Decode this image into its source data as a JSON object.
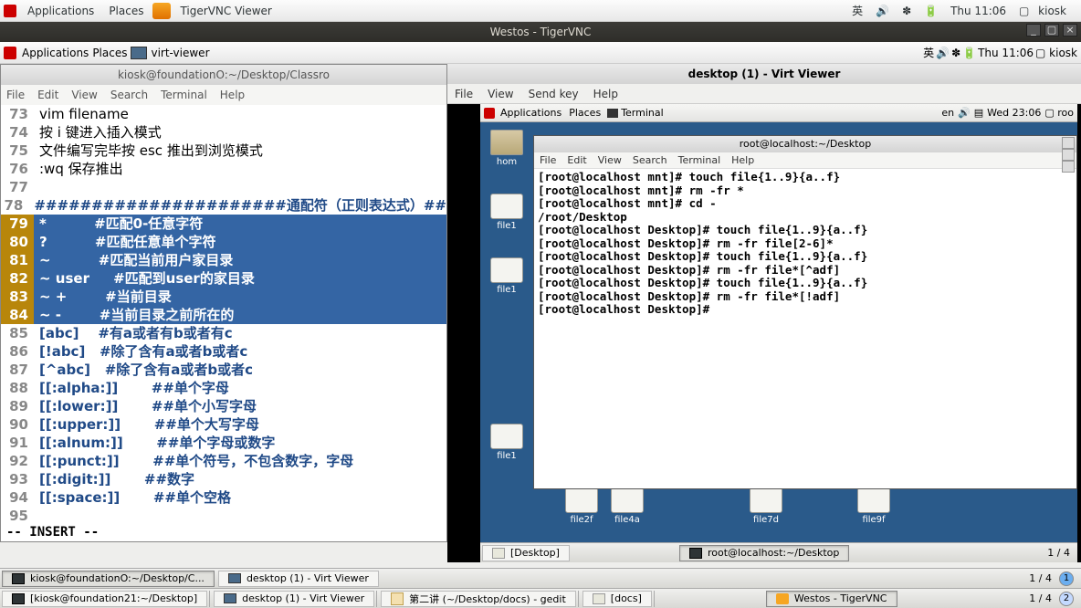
{
  "outer_panel": {
    "apps": "Applications",
    "places": "Places",
    "app_label": "TigerVNC Viewer",
    "ime": "英",
    "clock": "Thu 11:06",
    "user": "kiosk"
  },
  "vnc_title": "Westos - TigerVNC",
  "inner_panel": {
    "apps": "Applications",
    "places": "Places",
    "app_label": "virt-viewer",
    "ime": "英",
    "clock": "Thu 11:06",
    "user": "kiosk"
  },
  "gedit": {
    "title": "kiosk@foundationO:~/Desktop/Classro",
    "menu": [
      "File",
      "Edit",
      "View",
      "Search",
      "Terminal",
      "Help"
    ],
    "lines": [
      {
        "n": "73",
        "sel": false,
        "text": "vim filename",
        "style": "plain"
      },
      {
        "n": "74",
        "sel": false,
        "text": "按 i 键进入插入模式",
        "style": "plain"
      },
      {
        "n": "75",
        "sel": false,
        "text": "文件编写完毕按 esc 推出到浏览模式",
        "style": "plain"
      },
      {
        "n": "76",
        "sel": false,
        "text": ":wq 保存推出",
        "style": "plain"
      },
      {
        "n": "77",
        "sel": false,
        "text": "",
        "style": "plain"
      },
      {
        "n": "78",
        "sel": false,
        "text": "######################通配符（正则表达式）##",
        "style": "blue"
      },
      {
        "n": "79",
        "sel": true,
        "text": "*          #匹配0-任意字符",
        "style": "sel"
      },
      {
        "n": "80",
        "sel": true,
        "text": "?          #匹配任意单个字符",
        "style": "sel"
      },
      {
        "n": "81",
        "sel": true,
        "text": "~          #匹配当前用户家目录",
        "style": "sel"
      },
      {
        "n": "82",
        "sel": true,
        "text": "~ user     #匹配到user的家目录",
        "style": "sel"
      },
      {
        "n": "83",
        "sel": true,
        "text": "~ +        #当前目录",
        "style": "sel"
      },
      {
        "n": "84",
        "sel": true,
        "text": "~ -        #当前目录之前所在的",
        "style": "sel"
      },
      {
        "n": "85",
        "sel": false,
        "text": "[abc]    #有a或者有b或者有c",
        "style": "blue"
      },
      {
        "n": "86",
        "sel": false,
        "text": "[!abc]   #除了含有a或者b或者c",
        "style": "blue"
      },
      {
        "n": "87",
        "sel": false,
        "text": "[^abc]   #除了含有a或者b或者c",
        "style": "blue"
      },
      {
        "n": "88",
        "sel": false,
        "text": "[[:alpha:]]       ##单个字母",
        "style": "blue"
      },
      {
        "n": "89",
        "sel": false,
        "text": "[[:lower:]]       ##单个小写字母",
        "style": "blue"
      },
      {
        "n": "90",
        "sel": false,
        "text": "[[:upper:]]       ##单个大写字母",
        "style": "blue"
      },
      {
        "n": "91",
        "sel": false,
        "text": "[[:alnum:]]       ##单个字母或数字",
        "style": "blue"
      },
      {
        "n": "92",
        "sel": false,
        "text": "[[:punct:]]       ##单个符号，不包含数字，字母",
        "style": "blue"
      },
      {
        "n": "93",
        "sel": false,
        "text": "[[:digit:]]       ##数字",
        "style": "blue"
      },
      {
        "n": "94",
        "sel": false,
        "text": "[[:space:]]       ##单个空格",
        "style": "blue"
      },
      {
        "n": "95",
        "sel": false,
        "text": "",
        "style": "plain"
      }
    ],
    "status": "-- INSERT --"
  },
  "virt": {
    "title": "desktop (1) - Virt Viewer",
    "menu": [
      "File",
      "View",
      "Send key",
      "Help"
    ],
    "panel": {
      "apps": "Applications",
      "places": "Places",
      "app": "Terminal",
      "ime": "en",
      "clock": "Wed 23:06",
      "user": "roo"
    },
    "home": "hom",
    "icons_left": [
      "file1",
      "file1"
    ],
    "icons_bottom": [
      "file2f",
      "file4a",
      "file7d",
      "file9f"
    ],
    "icons_row2_left": "file1",
    "term": {
      "title": "root@localhost:~/Desktop",
      "menu": [
        "File",
        "Edit",
        "View",
        "Search",
        "Terminal",
        "Help"
      ],
      "lines": [
        "[root@localhost mnt]# touch file{1..9}{a..f}",
        "[root@localhost mnt]# rm -fr *",
        "[root@localhost mnt]# cd -",
        "/root/Desktop",
        "[root@localhost Desktop]# touch file{1..9}{a..f}",
        "[root@localhost Desktop]# rm -fr file[2-6]*",
        "[root@localhost Desktop]# touch file{1..9}{a..f}",
        "[root@localhost Desktop]# rm -fr file*[^adf]",
        "[root@localhost Desktop]# touch file{1..9}{a..f}",
        "[root@localhost Desktop]# rm -fr file*[!adf]",
        "[root@localhost Desktop]# "
      ]
    },
    "taskbar": {
      "t1": "[Desktop]",
      "t2": "root@localhost:~/Desktop",
      "ws": "1 / 4"
    }
  },
  "outer_tb1": {
    "t1": "kiosk@foundationO:~/Desktop/C...",
    "t2": "desktop (1) - Virt Viewer",
    "ws": "1 / 4"
  },
  "outer_tb2": {
    "t1": "[kiosk@foundation21:~/Desktop]",
    "t2": "desktop (1) - Virt Viewer",
    "t3": "第二讲 (~/Desktop/docs) - gedit",
    "t4": "[docs]",
    "t5": "Westos - TigerVNC",
    "ws": "1 / 4"
  }
}
